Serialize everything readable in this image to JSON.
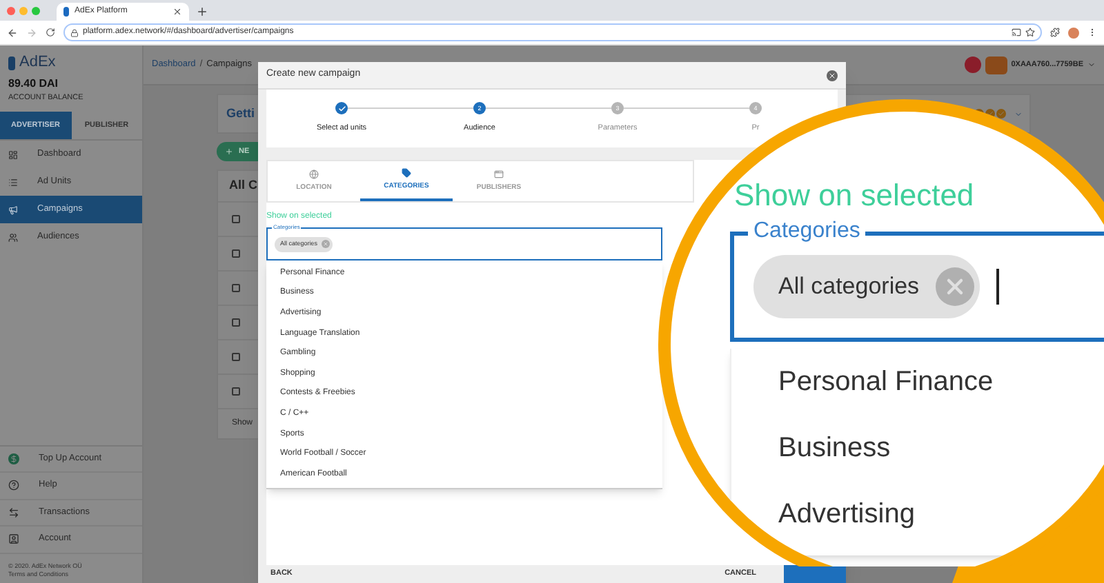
{
  "browser": {
    "tab_title": "AdEx Platform",
    "url": "platform.adex.network/#/dashboard/advertiser/campaigns"
  },
  "sidebar": {
    "logo": "AdEx",
    "balance": "89.40 DAI",
    "balance_label": "ACCOUNT BALANCE",
    "modes": [
      {
        "label": "ADVERTISER",
        "selected": true
      },
      {
        "label": "PUBLISHER",
        "selected": false
      }
    ],
    "nav": [
      {
        "label": "Dashboard",
        "selected": false
      },
      {
        "label": "Ad Units",
        "selected": false
      },
      {
        "label": "Campaigns",
        "selected": true
      },
      {
        "label": "Audiences",
        "selected": false
      }
    ],
    "bottom_nav": [
      {
        "label": "Top Up Account"
      },
      {
        "label": "Help"
      },
      {
        "label": "Transactions"
      },
      {
        "label": "Account"
      }
    ],
    "copyright": "© 2020. AdEx Network OÜ",
    "terms": "Terms and Conditions"
  },
  "header": {
    "breadcrumb": {
      "link": "Dashboard",
      "separator": "/",
      "current": "Campaigns"
    },
    "address": "0XAAA760...7759BE"
  },
  "background": {
    "card_title": "Getti",
    "new_button": "NE",
    "list_title": "All C",
    "rows": [
      {
        "checked": false
      },
      {
        "checked": false
      },
      {
        "checked": false
      },
      {
        "checked": false
      },
      {
        "checked": false
      },
      {
        "checked": false
      }
    ],
    "footer": "Show"
  },
  "modal": {
    "title": "Create new campaign",
    "steps": [
      {
        "label": "Select ad units",
        "kind": "done"
      },
      {
        "label": "Audience",
        "number": "2",
        "kind": "active"
      },
      {
        "label": "Parameters",
        "number": "3",
        "kind": "pending"
      },
      {
        "label": "Pr",
        "number": "4",
        "kind": "pending"
      }
    ],
    "tabs": [
      {
        "label": "LOCATION",
        "selected": false
      },
      {
        "label": "CATEGORIES",
        "selected": true
      },
      {
        "label": "PUBLISHERS",
        "selected": false
      }
    ],
    "hint": "Show on selected",
    "field_label": "Categories",
    "chips": [
      "All categories"
    ],
    "options": [
      "Personal Finance",
      "Business",
      "Advertising",
      "Language Translation",
      "Gambling",
      "Shopping",
      "Contests & Freebies",
      "C / C++",
      "Sports",
      "World Football / Soccer",
      "American Football"
    ],
    "back": "BACK",
    "cancel": "CANCEL"
  },
  "magnifier": {
    "hint": "Show on selected",
    "field_label": "Categories",
    "chips": [
      "All categories"
    ],
    "options": [
      "Personal Finance",
      "Business",
      "Advertising"
    ]
  }
}
